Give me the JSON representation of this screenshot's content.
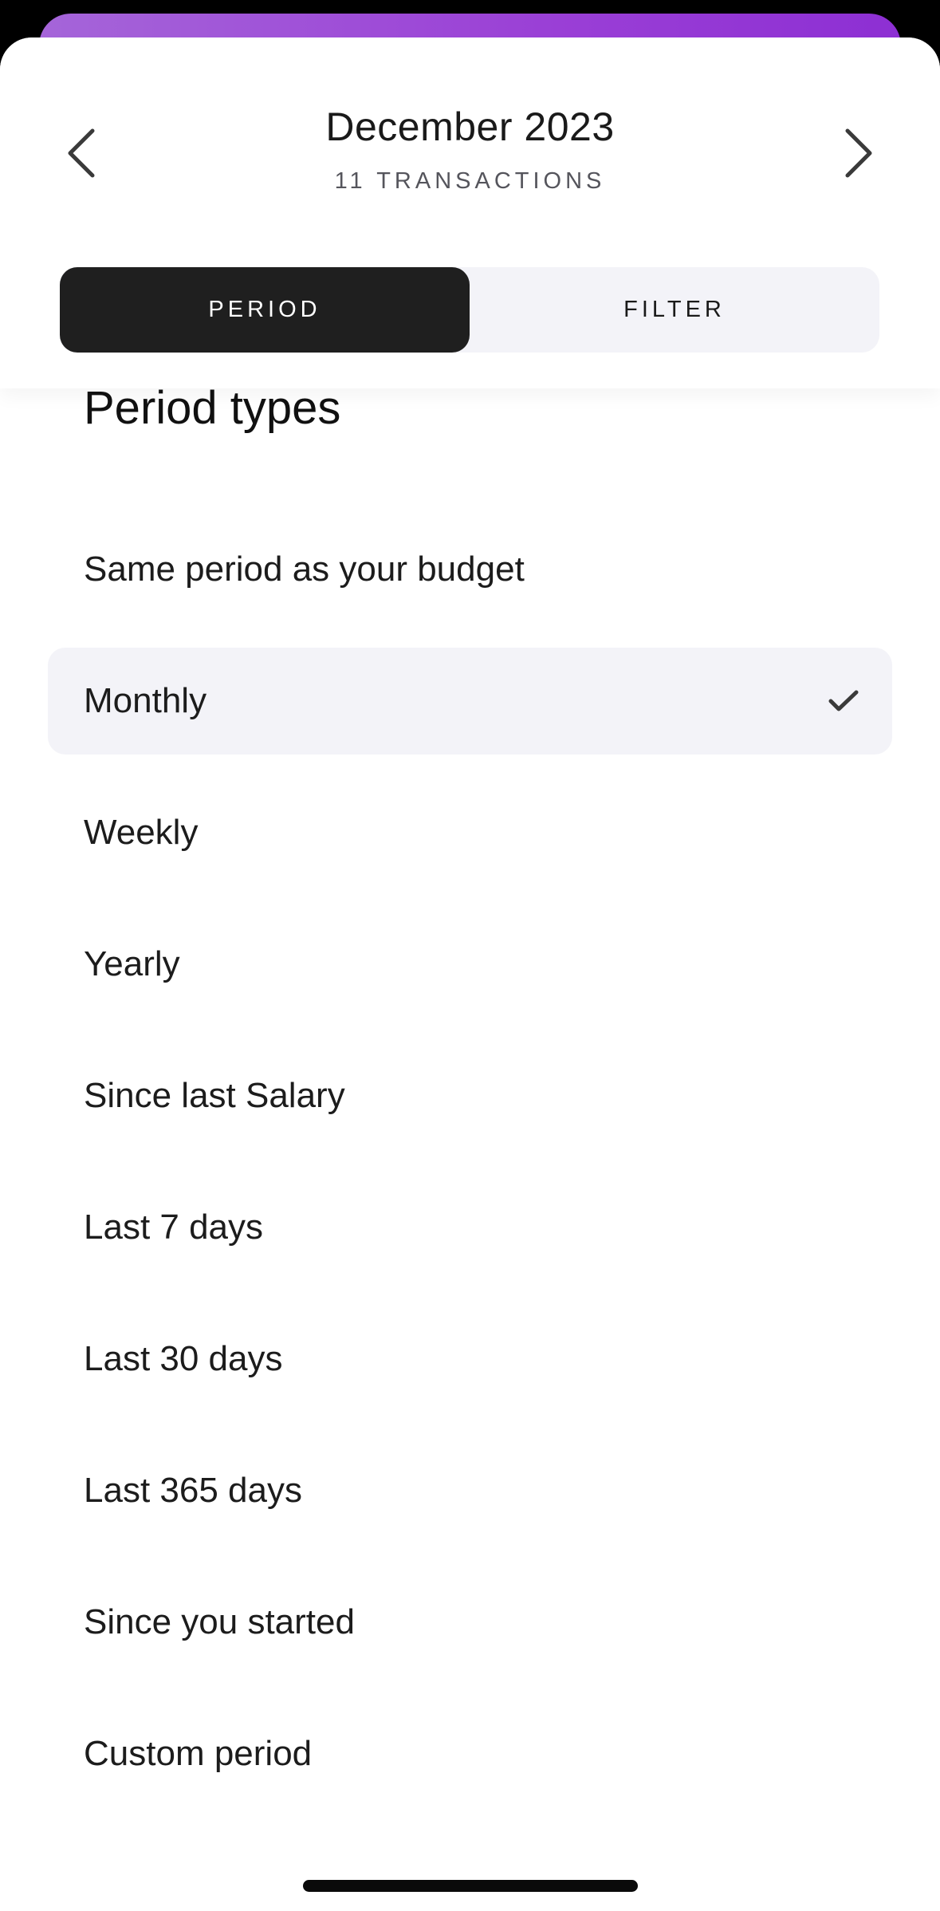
{
  "header": {
    "title": "December 2023",
    "subtitle": "11 TRANSACTIONS"
  },
  "tabs": [
    {
      "label": "PERIOD",
      "active": true
    },
    {
      "label": "FILTER",
      "active": false
    }
  ],
  "section": {
    "title": "Period types"
  },
  "options": [
    {
      "label": "Same period as your budget",
      "selected": false
    },
    {
      "label": "Monthly",
      "selected": true
    },
    {
      "label": "Weekly",
      "selected": false
    },
    {
      "label": "Yearly",
      "selected": false
    },
    {
      "label": "Since last Salary",
      "selected": false
    },
    {
      "label": "Last 7 days",
      "selected": false
    },
    {
      "label": "Last 30 days",
      "selected": false
    },
    {
      "label": "Last 365 days",
      "selected": false
    },
    {
      "label": "Since you started",
      "selected": false
    },
    {
      "label": "Custom period",
      "selected": false
    }
  ],
  "icons": {
    "prev": "chevron-left-icon",
    "next": "chevron-right-icon",
    "check": "checkmark-icon"
  },
  "colors": {
    "accent_gradient_start": "#a565d9",
    "accent_gradient_end": "#8d2fd3",
    "active_tab": "#1f1f1f",
    "tab_track": "#f3f3f8",
    "selected_row": "#f3f3f8"
  }
}
